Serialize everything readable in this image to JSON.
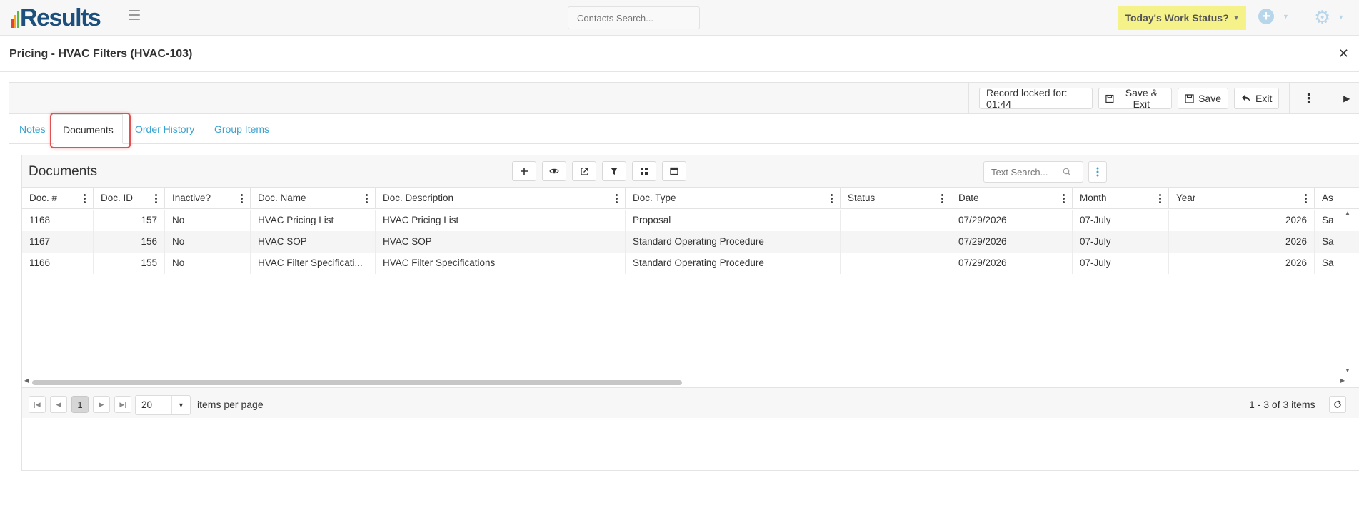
{
  "header": {
    "logo_text": "Results",
    "contacts_search_placeholder": "Contacts Search...",
    "work_status_label": "Today's Work Status?",
    "plus_icon": "plus-circle-icon",
    "gear_icon": "gear-icon",
    "accent_color": "#3aa2cf",
    "work_status_color": "#f5f28a"
  },
  "page": {
    "title": "Pricing - HVAC Filters (HVAC-103)"
  },
  "toolbar": {
    "record_locked": "Record locked for: 01:44",
    "save_exit_label": "Save & Exit",
    "save_label": "Save",
    "exit_label": "Exit"
  },
  "tabs": [
    {
      "label": "Notes"
    },
    {
      "label": "Documents"
    },
    {
      "label": "Order History"
    },
    {
      "label": "Group Items"
    }
  ],
  "documents": {
    "title": "Documents",
    "search_placeholder": "Text Search...",
    "columns": [
      "Doc. #",
      "Doc. ID",
      "Inactive?",
      "Doc. Name",
      "Doc. Description",
      "Doc. Type",
      "Status",
      "Date",
      "Month",
      "Year",
      "As"
    ],
    "rows": [
      {
        "doc_num": "1168",
        "doc_id": "157",
        "inactive": "No",
        "name": "HVAC Pricing List",
        "description": "HVAC Pricing List",
        "type": "Proposal",
        "status": "",
        "date": "07/29/2026",
        "month": "07-July",
        "year": "2026",
        "as": "Sa"
      },
      {
        "doc_num": "1167",
        "doc_id": "156",
        "inactive": "No",
        "name": "HVAC SOP",
        "description": "HVAC SOP",
        "type": "Standard Operating Procedure",
        "status": "",
        "date": "07/29/2026",
        "month": "07-July",
        "year": "2026",
        "as": "Sa"
      },
      {
        "doc_num": "1166",
        "doc_id": "155",
        "inactive": "No",
        "name": "HVAC Filter Specificati...",
        "description": "HVAC Filter Specifications",
        "type": "Standard Operating Procedure",
        "status": "",
        "date": "07/29/2026",
        "month": "07-July",
        "year": "2026",
        "as": "Sa"
      }
    ],
    "pager": {
      "current_page": "1",
      "per_page": "20",
      "per_page_label": "items per page",
      "count_text": "1 - 3 of 3 items"
    }
  }
}
